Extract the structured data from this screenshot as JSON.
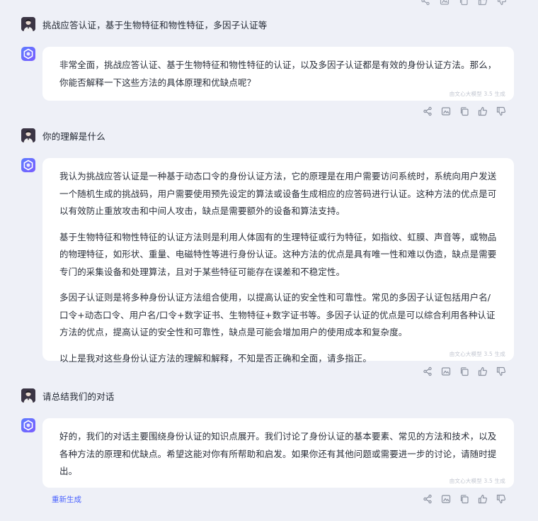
{
  "conversation": {
    "user_messages": [
      "挑战应答认证，基于生物特征和物性特征，多因子认证等",
      "你的理解是什么",
      "请总结我们的对话"
    ],
    "bot_messages": [
      {
        "paragraphs": [
          "非常全面，挑战应答认证、基于生物特征和物性特征的认证，以及多因子认证都是有效的身份认证方法。那么，你能否解释一下这些方法的具体原理和优缺点呢？"
        ],
        "source": "由文心大模型 3.5 生成"
      },
      {
        "paragraphs": [
          "我认为挑战应答认证是一种基于动态口令的身份认证方法，它的原理是在用户需要访问系统时，系统向用户发送一个随机生成的挑战码，用户需要使用预先设定的算法或设备生成相应的应答码进行认证。这种方法的优点是可以有效防止重放攻击和中间人攻击，缺点是需要额外的设备和算法支持。",
          "基于生物特征和物性特征的认证方法则是利用人体固有的生理特征或行为特征，如指纹、虹膜、声音等，或物品的物理特征，如形状、重量、电磁特性等进行身份认证。这种方法的优点是具有唯一性和难以伪造，缺点是需要专门的采集设备和处理算法，且对于某些特征可能存在误差和不稳定性。",
          "多因子认证则是将多种身份认证方法组合使用，以提高认证的安全性和可靠性。常见的多因子认证包括用户名/口令+动态口令、用户名/口令+数字证书、生物特征+数字证书等。多因子认证的优点是可以综合利用各种认证方法的优点，提高认证的安全性和可靠性，缺点是可能会增加用户的使用成本和复杂度。",
          "以上是我对这些身份认证方法的理解和解释，不知是否正确和全面，请多指正。"
        ],
        "source": "由文心大模型 3.5 生成"
      },
      {
        "paragraphs": [
          "好的，我们的对话主要围绕身份认证的知识点展开。我们讨论了身份认证的基本要素、常见的方法和技术，以及各种方法的原理和优缺点。希望这能对你有所帮助和启发。如果你还有其他问题或需要进一步的讨论，请随时提出。"
        ],
        "source": "由文心大模型 3.5 生成"
      }
    ],
    "regenerate_label": "重新生成"
  },
  "icons": {
    "actions": [
      "share-icon",
      "image-icon",
      "copy-icon",
      "thumb-up-icon",
      "thumb-down-icon"
    ]
  },
  "colors": {
    "background": "#eef0f7",
    "bubble": "#ffffff",
    "accent": "#4b63ff",
    "bot_avatar_start": "#5d7cff",
    "bot_avatar_end": "#7a5cff",
    "user_avatar": "#3b3545"
  }
}
